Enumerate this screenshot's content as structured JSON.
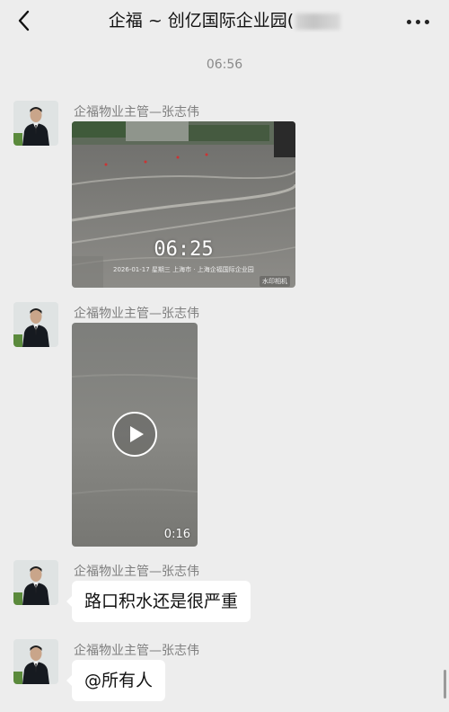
{
  "header": {
    "title": "企福 ~ 创亿国际企业园(",
    "back_icon": "chevron-left-icon",
    "more_icon": "more-dots-icon"
  },
  "chat": {
    "timestamp": "06:56",
    "messages": [
      {
        "sender": "企福物业主管—张志伟",
        "type": "image",
        "overlay_time": "06:25",
        "overlay_location": "2026-01-17  星期三  上海市 · 上海企福国际企业园",
        "overlay_brand": "水印相机"
      },
      {
        "sender": "企福物业主管—张志伟",
        "type": "video",
        "duration": "0:16"
      },
      {
        "sender": "企福物业主管—张志伟",
        "type": "text",
        "text": "路口积水还是很严重"
      },
      {
        "sender": "企福物业主管—张志伟",
        "type": "text",
        "text": "@所有人"
      }
    ]
  },
  "colors": {
    "background": "#ededed",
    "bubble": "#ffffff",
    "sender_text": "#7f7f7f",
    "timestamp_text": "#8a8a8a"
  }
}
